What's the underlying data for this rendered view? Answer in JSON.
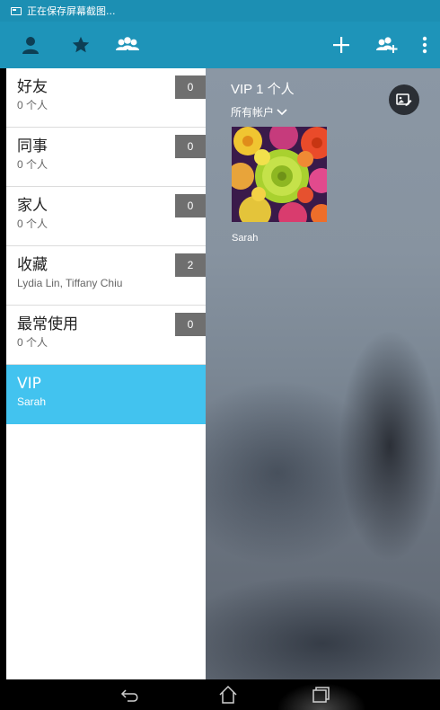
{
  "status_bar": {
    "text": "正在保存屏幕截图..."
  },
  "action_bar": {
    "left_icons": [
      "person-icon",
      "star-icon",
      "group-icon"
    ],
    "right_icons": [
      "add-icon",
      "add-group-icon",
      "overflow-menu-icon"
    ],
    "color": "#1e94b9"
  },
  "groups": [
    {
      "name": "好友",
      "sub": "0 个人",
      "count": "0"
    },
    {
      "name": "同事",
      "sub": "0 个人",
      "count": "0"
    },
    {
      "name": "家人",
      "sub": "0 个人",
      "count": "0"
    },
    {
      "name": "收藏",
      "sub": "Lydia Lin, Tiffany Chiu",
      "count": "2"
    },
    {
      "name": "最常使用",
      "sub": "0 个人",
      "count": "0"
    },
    {
      "name": "VIP",
      "sub": "Sarah",
      "count": ""
    }
  ],
  "selected_group": "VIP",
  "detail": {
    "title": "VIP 1 个人",
    "account_filter": "所有帐户",
    "contacts": [
      {
        "name": "Sarah"
      }
    ]
  },
  "colors": {
    "accent": "#42c3ef",
    "status_bar": "#1c8fb3",
    "count_badge": "#6f6f6f"
  }
}
